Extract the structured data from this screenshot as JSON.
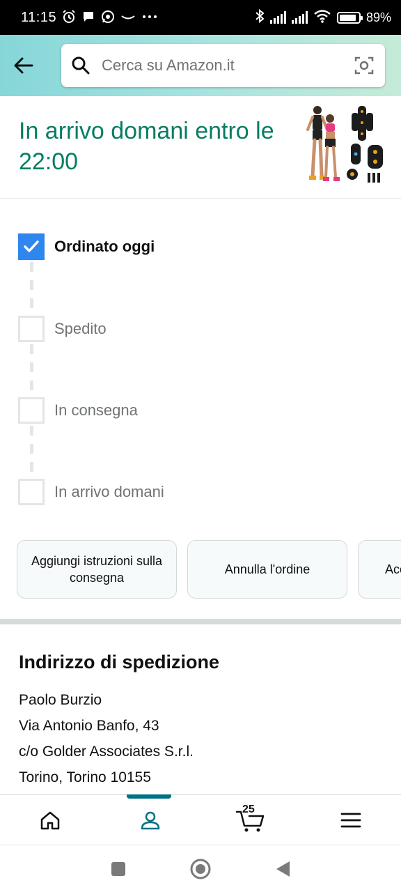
{
  "status_bar": {
    "time": "11:15",
    "battery": "89%",
    "battery_level": 0.89,
    "icons": [
      "alarm-icon",
      "chat-bubble-icon",
      "whatsapp-icon",
      "amazon-smile-icon",
      "more-dots-icon",
      "bluetooth-icon",
      "signal-icon",
      "signal-icon",
      "wifi-icon",
      "battery-icon"
    ]
  },
  "header": {
    "search_placeholder": "Cerca su Amazon.it",
    "icons": [
      "back-arrow-icon",
      "search-icon",
      "camera-icon"
    ]
  },
  "delivery": {
    "title": "In arrivo domani entro le 22:00",
    "accent_color": "#067d62"
  },
  "tracker": {
    "steps": [
      {
        "label": "Ordinato oggi",
        "completed": true
      },
      {
        "label": "Spedito",
        "completed": false
      },
      {
        "label": "In consegna",
        "completed": false
      },
      {
        "label": "In arrivo domani",
        "completed": false
      }
    ],
    "check_color": "#2f86ee"
  },
  "actions": [
    {
      "label": "Aggiungi istruzioni sulla consegna"
    },
    {
      "label": "Annulla l'ordine"
    },
    {
      "label": "Acc"
    }
  ],
  "address": {
    "title": "Indirizzo di spedizione",
    "lines": [
      "Paolo Burzio",
      "Via Antonio Banfo, 43",
      "c/o Golder Associates S.r.l.",
      "Torino, Torino 10155"
    ]
  },
  "bottom_nav": {
    "items": [
      {
        "name": "home",
        "icon": "home-icon"
      },
      {
        "name": "account",
        "icon": "user-icon",
        "active": true
      },
      {
        "name": "cart",
        "icon": "cart-icon",
        "count": "25"
      },
      {
        "name": "menu",
        "icon": "hamburger-menu-icon"
      }
    ],
    "active_color": "#007185"
  },
  "system_nav": {
    "icons": [
      "recents-square-icon",
      "home-circle-icon",
      "back-triangle-icon"
    ]
  }
}
